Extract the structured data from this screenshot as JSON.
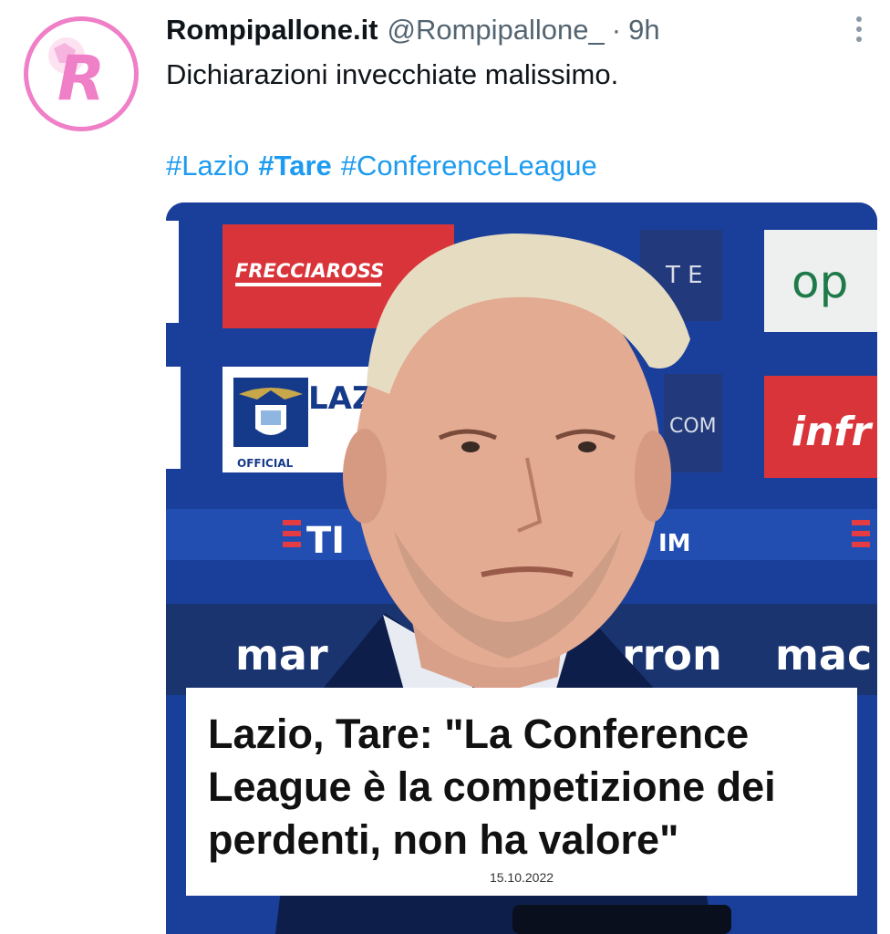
{
  "tweet": {
    "author_name": "Rompipallone.it",
    "author_handle": "@Rompipallone_",
    "separator": "·",
    "time": "9h",
    "text": "Dichiarazioni invecchiate malissimo.",
    "hashtags": [
      {
        "label": "#Lazio",
        "bold": false
      },
      {
        "label": "#Tare",
        "bold": true
      },
      {
        "label": "#ConferenceLeague",
        "bold": false
      }
    ],
    "more_icon": "more-vertical-icon",
    "avatar_letter": "R"
  },
  "media": {
    "headline": "Lazio, Tare: \"La Conference\nLeague è la competizione dei\nperdenti, non ha valore\"",
    "date": "15.10.2022",
    "sponsor_texts": {
      "frecciarossa": "FRECCIAROSS",
      "te": "T E",
      "op": "op",
      "lazio": "LAZ",
      "lazio_sub": "OFFICIAL",
      "com": "COM",
      "infr": "infr",
      "tim_left": "TI",
      "tim_right": "IM",
      "macron_left": "mar",
      "macron_mid": "rron",
      "macron_right": "mac"
    }
  },
  "colors": {
    "accent_link": "#1d9bf0",
    "avatar_pink": "#ef7fc7",
    "backdrop_blue": "#1a3f9a"
  }
}
